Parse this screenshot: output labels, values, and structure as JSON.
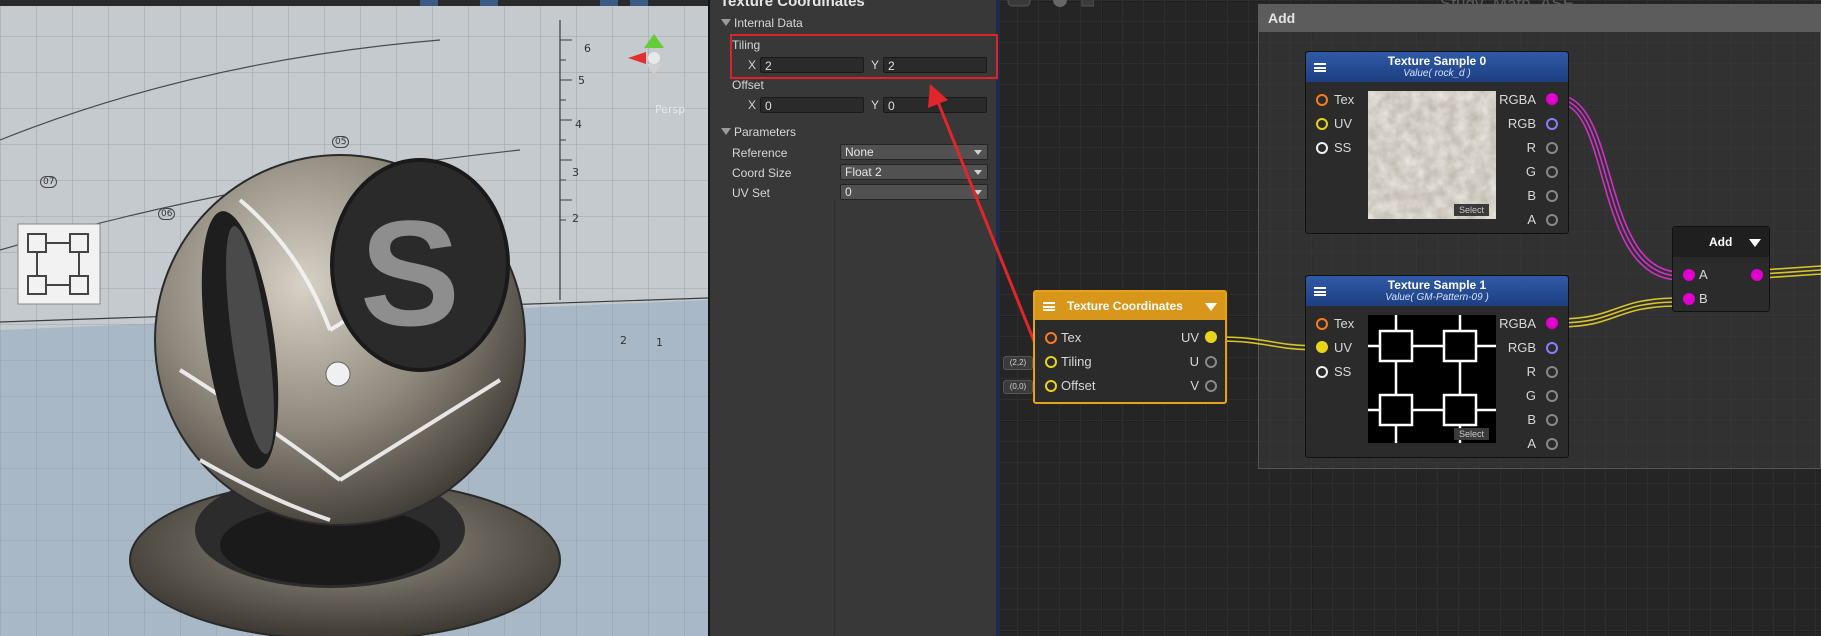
{
  "inspector": {
    "title": "Texture Coordinates",
    "internal_data_section": "Internal Data",
    "tiling_label": "Tiling",
    "tiling_x_label": "X",
    "tiling_x_value": "2",
    "tiling_y_label": "Y",
    "tiling_y_value": "2",
    "offset_label": "Offset",
    "offset_x_label": "X",
    "offset_x_value": "0",
    "offset_y_label": "Y",
    "offset_y_value": "0",
    "parameters_section": "Parameters",
    "params": [
      {
        "label": "Reference",
        "value": "None"
      },
      {
        "label": "Coord Size",
        "value": "Float 2"
      },
      {
        "label": "UV Set",
        "value": "0"
      }
    ]
  },
  "viewport": {
    "sphere_letter": "S",
    "ruler_labels": [
      "6",
      "5",
      "4",
      "3",
      "2",
      "1",
      "2"
    ],
    "circle_labels": [
      "07",
      "06",
      "05"
    ],
    "persp_label": "Persp"
  },
  "graph": {
    "canvas_title": "Study_Math_ASE",
    "frame_title": "Add",
    "tex_sample_0": {
      "title": "Texture Sample 0",
      "subtitle": "Value( rock_d )",
      "inputs": [
        "Tex",
        "UV",
        "SS"
      ],
      "outputs": [
        "RGBA",
        "RGB",
        "R",
        "G",
        "B",
        "A"
      ],
      "select": "Select"
    },
    "tex_sample_1": {
      "title": "Texture Sample 1",
      "subtitle": "Value( GM-Pattern-09 )",
      "inputs": [
        "Tex",
        "UV",
        "SS"
      ],
      "outputs": [
        "RGBA",
        "RGB",
        "R",
        "G",
        "B",
        "A"
      ],
      "select": "Select"
    },
    "tex_coords": {
      "title": "Texture Coordinates",
      "inputs": [
        "Tex",
        "Tiling",
        "Offset"
      ],
      "outputs": [
        "UV",
        "U",
        "V"
      ],
      "tiling_chip": "(2,2)",
      "offset_chip": "(0,0)"
    },
    "add_node": {
      "title": "Add",
      "inputs": [
        "A",
        "B"
      ]
    }
  },
  "colors": {
    "accent_highlight": "#d9242a",
    "node_header_blue": "#2a53a0",
    "node_header_orange": "#d8961a",
    "port_magenta": "#e000d0",
    "port_yellow": "#e8d419",
    "port_orange": "#ff7a1a",
    "port_purple": "#8a7fff"
  }
}
